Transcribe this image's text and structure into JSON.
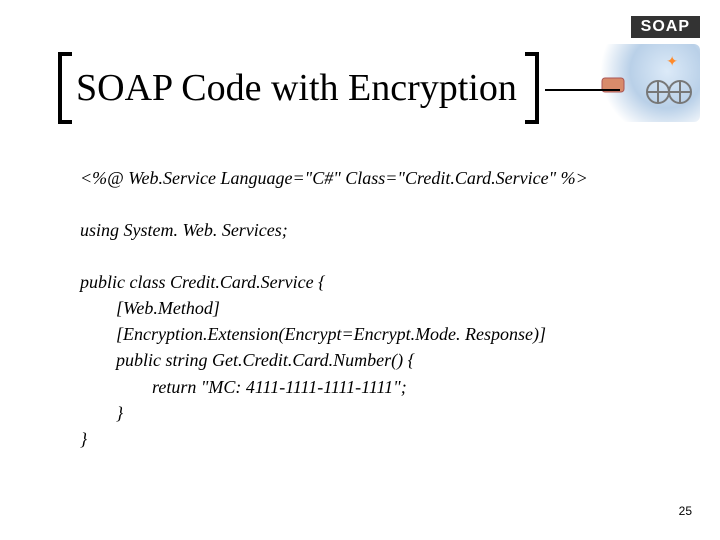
{
  "logo": {
    "label": "SOAP"
  },
  "title": "SOAP Code with Encryption",
  "code": {
    "l1": "<%@ Web.Service Language=\"C#\" Class=\"Credit.Card.Service\" %>",
    "l2": "using System. Web. Services;",
    "l3": "public class Credit.Card.Service {",
    "l4": "[Web.Method]",
    "l5": "[Encryption.Extension(Encrypt=Encrypt.Mode. Response)]",
    "l6": "public string Get.Credit.Card.Number() {",
    "l7": "return \"MC: 4111-1111-1111-1111\";",
    "l8": "}",
    "l9": "}"
  },
  "page_number": "25"
}
